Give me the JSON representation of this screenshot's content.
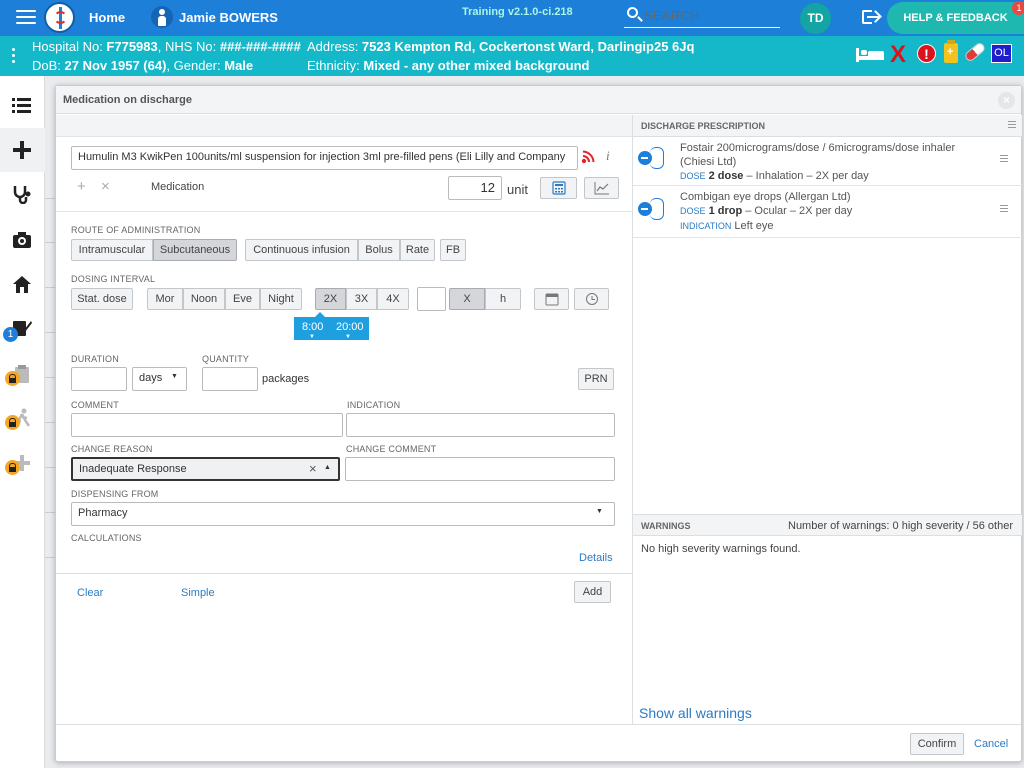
{
  "topbar": {
    "home": "Home",
    "user_name": "Jamie BOWERS",
    "version": "Training v2.1.0-ci.218",
    "search": "Search",
    "avatar": "TD",
    "help": "HELP & FEEDBACK",
    "help_badge": "1"
  },
  "patient": {
    "line1_left_label": "Hospital No: ",
    "hospital_no": "F775983",
    "nhs_label": ", NHS No: ",
    "nhs_no": "###-###-####",
    "address_label": "Address: ",
    "address": "7523 Kempton Rd, Cockertonst Ward, Darlingip25 6Jq",
    "dob_label": "DoB: ",
    "dob": "27 Nov 1957 (64)",
    "gender_label": ", Gender: ",
    "gender": "Male",
    "ethnicity_label": "Ethnicity: ",
    "ethnicity": "Mixed - any other mixed background",
    "ol_badge": "OL",
    "alert_mark": "!",
    "allergy_mark": "X"
  },
  "sidebar": {
    "badge": "1"
  },
  "modal": {
    "title": "Medication on discharge",
    "close": "×",
    "medication_value": "Humulin M3 KwikPen 100units/ml suspension for injection 3ml pre-filled pens (Eli Lilly and Company",
    "add_icon": "+",
    "remove_icon": "×",
    "medication_label": "Medication",
    "quantity_value": "12",
    "unit_label": "unit",
    "route_label": "ROUTE OF ADMINISTRATION",
    "routes": [
      "Intramuscular",
      "Subcutaneous"
    ],
    "route_selected": "Subcutaneous",
    "rate_buttons": [
      "Continuous infusion",
      "Bolus",
      "Rate"
    ],
    "fb": "FB",
    "dosing_label": "DOSING INTERVAL",
    "stat_dose": "Stat. dose",
    "times_of_day": [
      "Mor",
      "Noon",
      "Eve",
      "Night"
    ],
    "frequency": [
      "2X",
      "3X",
      "4X"
    ],
    "frequency_selected": "2X",
    "x_button": "X",
    "h_button": "h",
    "times": [
      "8:00",
      "20:00"
    ],
    "duration_label": "DURATION",
    "duration_unit": "days",
    "quantity_label": "QUANTITY",
    "packages": "packages",
    "prn": "PRN",
    "comment_label": "COMMENT",
    "indication_label": "INDICATION",
    "change_reason_label": "CHANGE REASON",
    "change_reason_value": "Inadequate Response",
    "clear_x": "×",
    "change_comment_label": "CHANGE COMMENT",
    "dispensing_label": "DISPENSING FROM",
    "dispensing_value": "Pharmacy",
    "calculations_label": "CALCULATIONS",
    "details_link": "Details",
    "clear_link": "Clear",
    "simple_link": "Simple",
    "add_button": "Add",
    "confirm_button": "Confirm",
    "cancel_link": "Cancel"
  },
  "prescription": {
    "title": "DISCHARGE PRESCRIPTION",
    "items": [
      {
        "name": "Fostair 200micrograms/dose / 6micrograms/dose inhaler (Chiesi Ltd)",
        "dose_key": "DOSE",
        "dose": "2 dose",
        "dose_rest": " – Inhalation – 2X per day"
      },
      {
        "name": "Combigan eye drops (Allergan Ltd)",
        "dose_key": "DOSE",
        "dose": "1 drop",
        "dose_rest": " – Ocular – 2X per day",
        "indication_key": "INDICATION",
        "indication": "Left eye"
      }
    ]
  },
  "warnings": {
    "title": "WARNINGS",
    "summary": "Number of warnings: 0 high severity / 56 other",
    "message": "No high severity warnings found.",
    "show_all": "Show all warnings"
  },
  "colors": {
    "topbar": "#1e7fd8",
    "patientbar": "#15b8c8",
    "accent_link": "#2b7bc4",
    "time_chip": "#1ea0e0"
  }
}
